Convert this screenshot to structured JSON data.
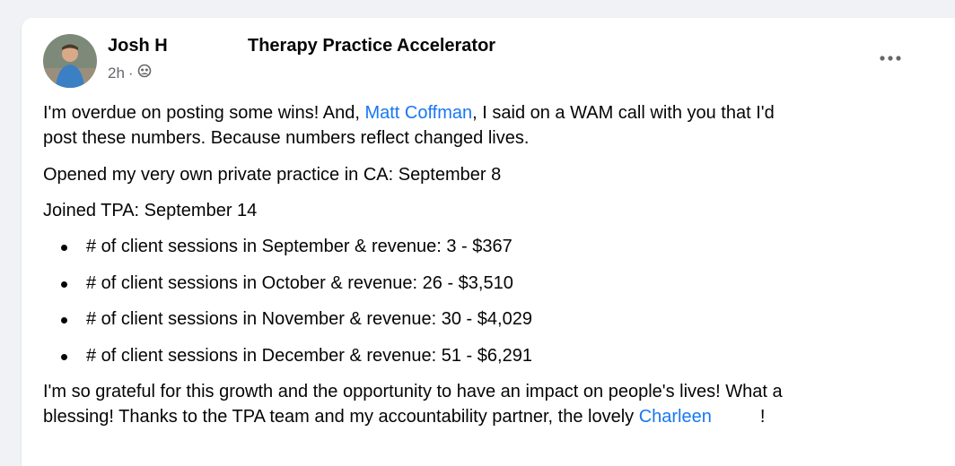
{
  "post": {
    "author": "Josh H",
    "group": "Therapy Practice Accelerator",
    "timestamp": "2h",
    "separator": "·",
    "audience_icon": "group-audience-icon",
    "more_icon": "more-options-icon",
    "paragraph1": {
      "before": "I'm overdue on posting some wins! And, ",
      "mention": "Matt Coffman",
      "after_line1": ", I said on a WAM call with you that I'd",
      "line2": "post these numbers. Because numbers reflect changed lives."
    },
    "paragraph2": "Opened my very own private practice in CA: September 8",
    "paragraph3": "Joined TPA: September 14",
    "wins": [
      "# of client sessions in September & revenue: 3 - $367",
      "# of client sessions in October & revenue: 26 - $3,510",
      "# of client sessions in November & revenue: 30 - $4,029",
      "# of client sessions in December & revenue: 51 - $6,291"
    ],
    "paragraph4": {
      "line1": "I'm so grateful for this growth and the opportunity to have an impact on people's lives! What a",
      "line2_before": "blessing! Thanks to the TPA team and my accountability partner, the lovely ",
      "mention": "Charleen",
      "end": "!"
    }
  },
  "colors": {
    "link": "#1877f2",
    "secondary_text": "#65676b",
    "background": "#f0f2f5"
  }
}
